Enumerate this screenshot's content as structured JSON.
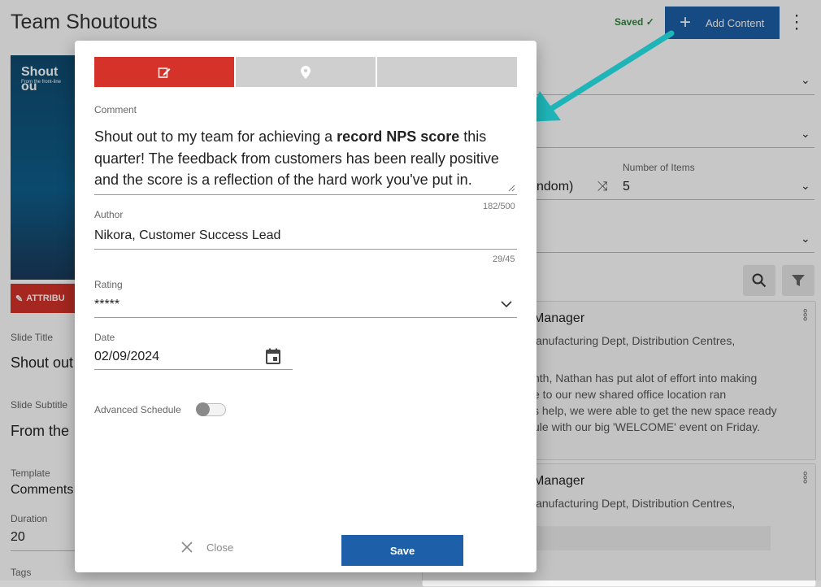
{
  "page": {
    "title": "Team Shoutouts",
    "saved_label": "Saved",
    "add_content_label": "Add Content"
  },
  "background": {
    "thumbnail_title": "Shout ou",
    "thumbnail_subtitle": "From the front-line",
    "attribute_button": "ATTRIBU",
    "fields": {
      "slide_title_label": "Slide Title",
      "slide_title_value": "Shout out",
      "slide_subtitle_label": "Slide Subtitle",
      "slide_subtitle_value": "From the",
      "template_label": "Template",
      "template_value": "Comments",
      "duration_label": "Duration",
      "duration_value": "20",
      "tags_label": "Tags"
    },
    "right": {
      "order_value_partial": "ndom)",
      "number_of_items_label": "Number of Items",
      "number_of_items_value": "5"
    },
    "cards": [
      {
        "title": "Manager",
        "subtitle": "lanufacturing Dept, Distribution Centres,",
        "text_lines": [
          "nth, Nathan has put alot of effort into making",
          "e to our new shared office location ran",
          "s help, we were able to get the new space ready",
          "ule with our big 'WELCOME' event on Friday."
        ]
      },
      {
        "title": "Manager",
        "subtitle": "lanufacturing Dept, Distribution Centres,"
      }
    ]
  },
  "modal": {
    "tabs": [
      {
        "icon": "edit-icon",
        "active": true
      },
      {
        "icon": "location-pin-icon",
        "active": false
      },
      {
        "icon": "",
        "active": false
      }
    ],
    "comment_label": "Comment",
    "comment_pre": "Shout out to my team for achieving a ",
    "comment_bold": "record NPS score",
    "comment_post": " this quarter! The feedback from customers has been really positive and the score is a reflection of the hard work you've put in.",
    "comment_counter": "182/500",
    "author_label": "Author",
    "author_value": "Nikora, Customer Success Lead",
    "author_counter": "29/45",
    "rating_label": "Rating",
    "rating_value": "*****",
    "date_label": "Date",
    "date_value": "02/09/2024",
    "advanced_schedule_label": "Advanced Schedule",
    "close_label": "Close",
    "save_label": "Save"
  },
  "colors": {
    "accent_red": "#d5322a",
    "primary_blue": "#1d5fa8",
    "arrow_teal": "#1fb5b8",
    "saved_green": "#2e8b3a"
  }
}
